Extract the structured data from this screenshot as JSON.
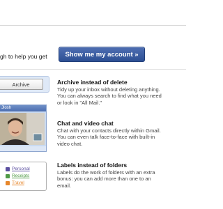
{
  "intro": {
    "text": "gh to help you get"
  },
  "cta": {
    "label": "Show me my account »"
  },
  "archive": {
    "button_label": "Archive",
    "title": "Archive instead of delete",
    "description": "Tidy up your inbox without deleting anything. You can always search to find what you need or look in \"All Mail.\""
  },
  "chat": {
    "title": "Chat and video chat",
    "description": "Chat with your contacts directly within Gmail. You can even talk face-to-face with built-in video chat.",
    "mock_header": "Jlosh"
  },
  "labels": {
    "title": "Labels instead of folders",
    "description": "Labels do the work of folders with an extra bonus: you can add more than one to an email.",
    "items": [
      {
        "name": "Personal",
        "color": "#5b4fa0"
      },
      {
        "name": "Receipts",
        "color": "#4f9a46"
      },
      {
        "name": "Travel",
        "color": "#e7872c"
      }
    ]
  }
}
